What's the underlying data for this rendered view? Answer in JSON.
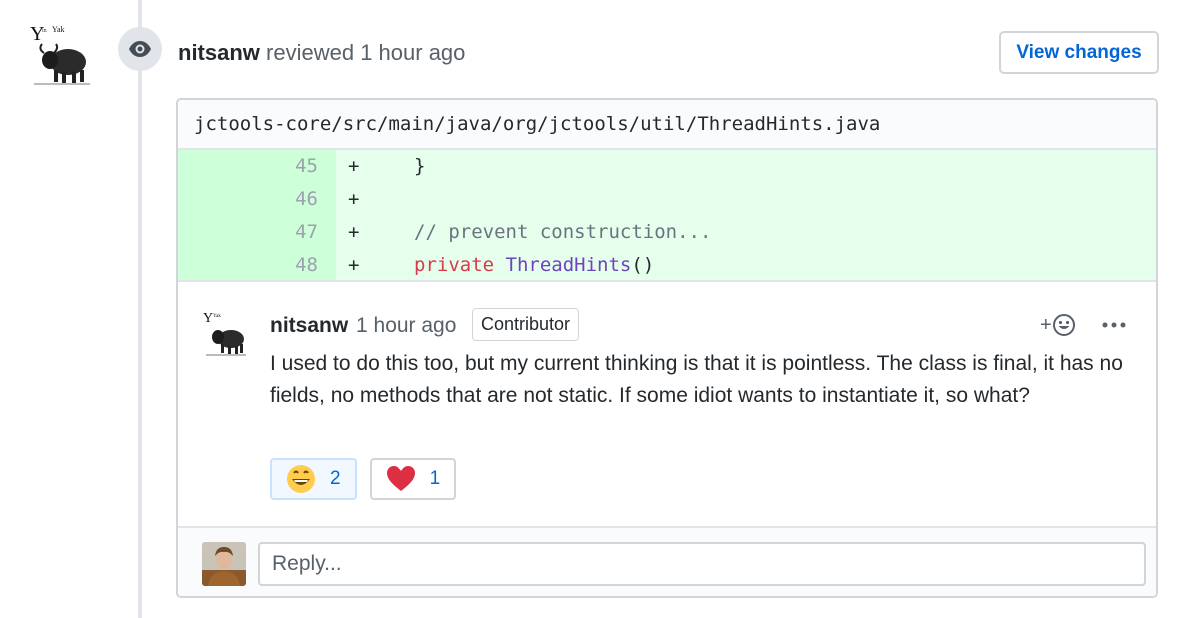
{
  "review": {
    "author": "nitsanw",
    "action": "reviewed",
    "time": "1 hour ago",
    "view_changes_label": "View changes"
  },
  "file": {
    "path": "jctools-core/src/main/java/org/jctools/util/ThreadHints.java"
  },
  "diff": {
    "lines": [
      {
        "num": "45",
        "sign": "+",
        "code": "}"
      },
      {
        "num": "46",
        "sign": "+",
        "code": ""
      },
      {
        "num": "47",
        "sign": "+",
        "code": "// prevent construction..."
      },
      {
        "num": "48",
        "sign": "+",
        "keyword": "private",
        "entity": "ThreadHints",
        "rest": "()"
      }
    ]
  },
  "comment": {
    "author": "nitsanw",
    "time": "1 hour ago",
    "badge": "Contributor",
    "add_reaction_label": "+",
    "body": "I used to do this too, but my current thinking is that it is pointless. The class is final, it has no fields, no methods that are not static. If some idiot wants to instantiate it, so what?",
    "reactions": [
      {
        "emoji": "smile",
        "count": "2",
        "active": true
      },
      {
        "emoji": "heart",
        "count": "1",
        "active": false
      }
    ]
  },
  "reply": {
    "placeholder": "Reply..."
  },
  "colors": {
    "link": "#0366d6",
    "diff_add_bg": "#e6ffed",
    "diff_add_num_bg": "#cdffd8",
    "keyword": "#d73a49",
    "entity": "#6f42c1"
  }
}
